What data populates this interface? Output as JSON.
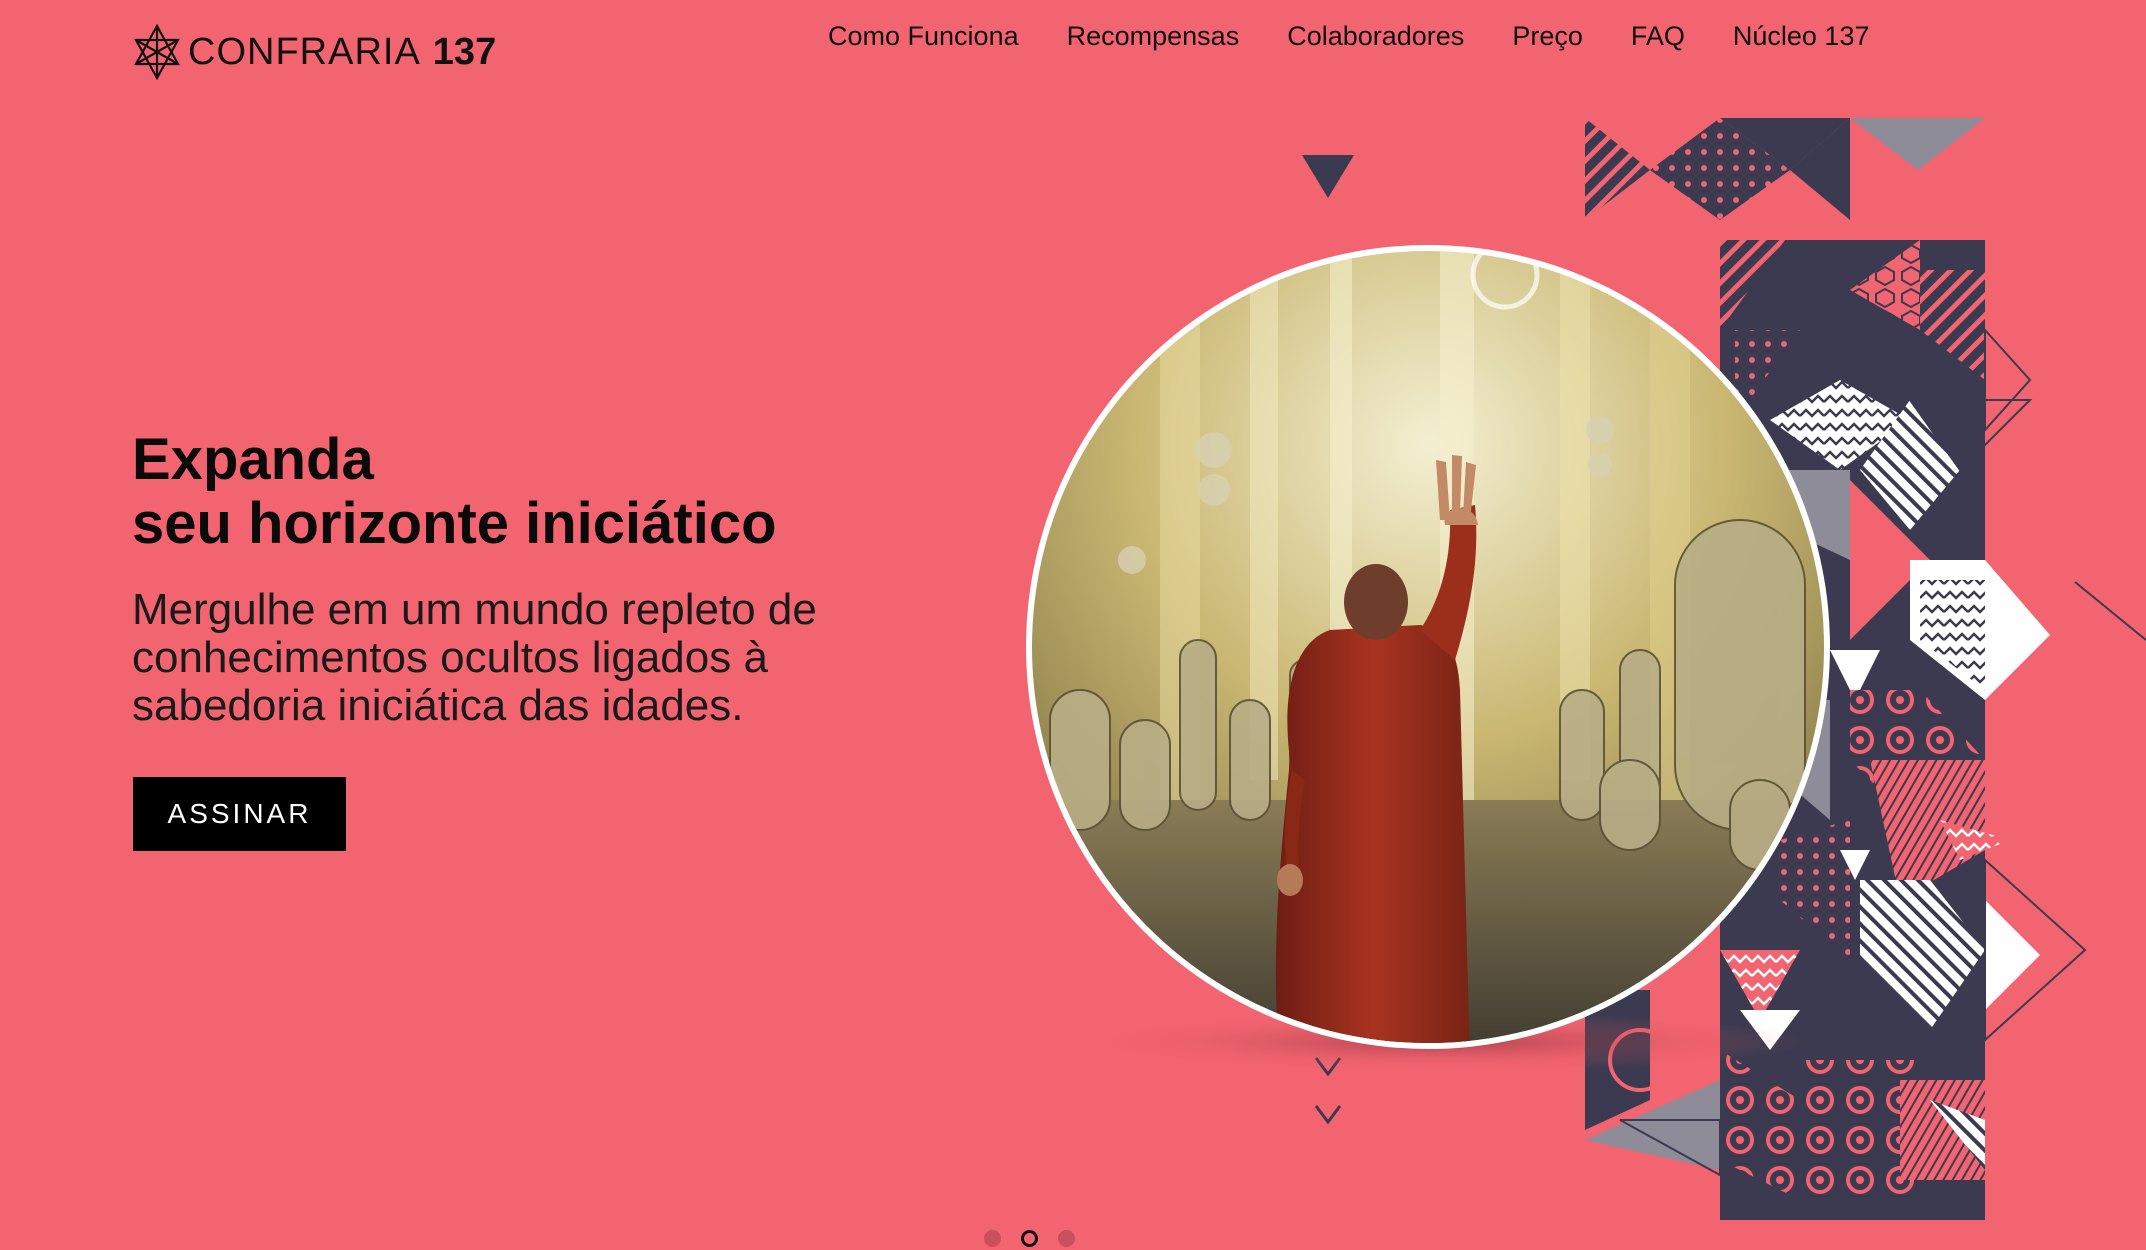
{
  "brand": {
    "name": "CONFRARIA",
    "number": "137",
    "icon": "merkaba-star-icon"
  },
  "nav": {
    "items": [
      {
        "label": "Como Funciona"
      },
      {
        "label": "Recompensas"
      },
      {
        "label": "Colaboradores"
      },
      {
        "label": "Preço"
      },
      {
        "label": "FAQ"
      },
      {
        "label": "Núcleo 137"
      }
    ]
  },
  "hero": {
    "title_line1": "Expanda",
    "title_line2": "seu horizonte iniciático",
    "subtitle_line1": "Mergulhe em um mundo repleto de",
    "subtitle_line2": "conhecimentos ocultos ligados à",
    "subtitle_line3": "sabedoria iniciática das idades.",
    "cta_label": "ASSINAR"
  },
  "carousel": {
    "slides": 3,
    "active_index": 1
  },
  "colors": {
    "background": "#f2646f",
    "navy": "#3b3a50",
    "gray": "#8e8c98",
    "button": "#000000",
    "button_text": "#ffffff"
  }
}
